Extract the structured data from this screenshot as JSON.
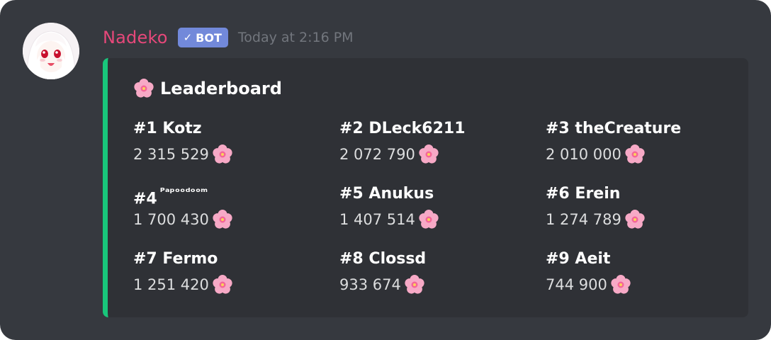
{
  "message": {
    "username": "Nadeko",
    "bot_tag": "BOT",
    "bot_check_icon": "checkmark-icon",
    "timestamp": "Today at 2:16 PM",
    "username_color": "#e6487a",
    "avatar_icon": "anime-girl-avatar"
  },
  "embed": {
    "accent_color": "#19c67b",
    "title_icon": "cherry-blossom-icon",
    "title": "Leaderboard",
    "fields": [
      {
        "rank": "#1",
        "name": "Kotz",
        "value": "2 315 529"
      },
      {
        "rank": "#2",
        "name": "DLeck6211",
        "value": "2 072 790"
      },
      {
        "rank": "#3",
        "name": "theCreature",
        "value": "2 010 000"
      },
      {
        "rank": "#4",
        "name": "ᴾᵃᵖᵒᵒᵈᵒᵒᵐ",
        "value": "1 700 430"
      },
      {
        "rank": "#5",
        "name": "Anukus",
        "value": "1 407 514"
      },
      {
        "rank": "#6",
        "name": "Erein",
        "value": "1 274 789"
      },
      {
        "rank": "#7",
        "name": "Fermo",
        "value": "1 251 420"
      },
      {
        "rank": "#8",
        "name": "Clossd",
        "value": "933 674"
      },
      {
        "rank": "#9",
        "name": "Aeit",
        "value": "744 900"
      }
    ]
  }
}
